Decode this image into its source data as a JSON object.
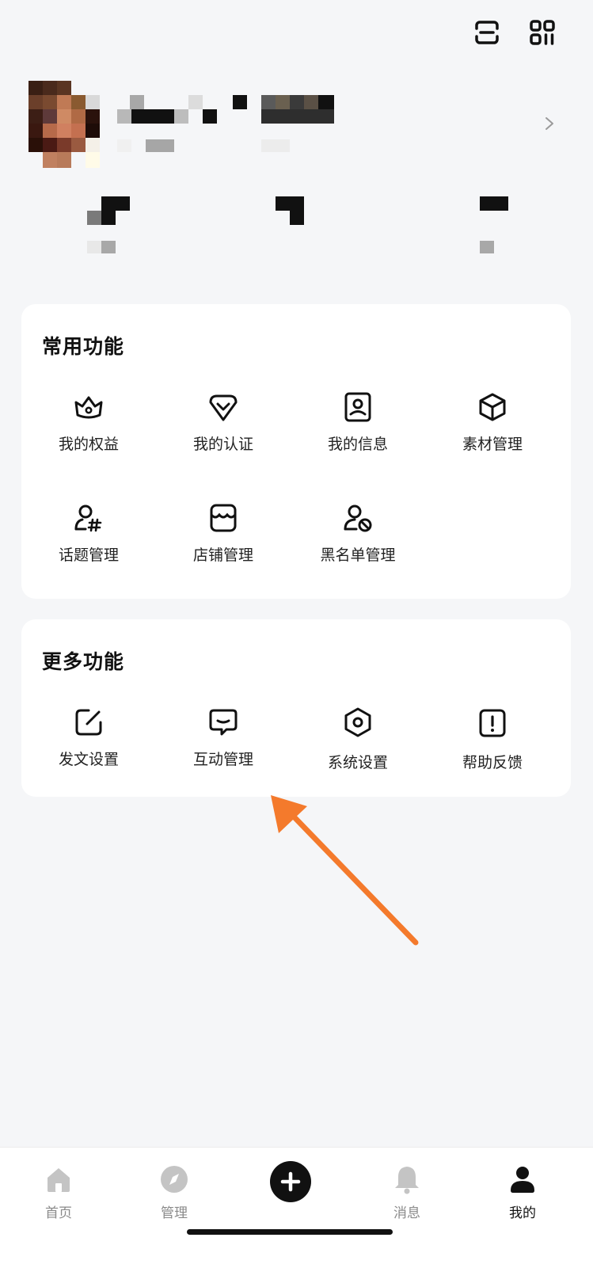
{
  "header": {
    "scan_icon": "scan-icon",
    "qr_icon": "qr-code-icon"
  },
  "profile": {
    "chevron_icon": "chevron-right-icon"
  },
  "common_functions": {
    "title": "常用功能",
    "items": [
      {
        "label": "我的权益",
        "icon": "crown-icon"
      },
      {
        "label": "我的认证",
        "icon": "badge-icon"
      },
      {
        "label": "我的信息",
        "icon": "user-card-icon"
      },
      {
        "label": "素材管理",
        "icon": "box-icon"
      },
      {
        "label": "话题管理",
        "icon": "user-hashtag-icon"
      },
      {
        "label": "店铺管理",
        "icon": "store-icon"
      },
      {
        "label": "黑名单管理",
        "icon": "user-block-icon"
      }
    ]
  },
  "more_functions": {
    "title": "更多功能",
    "items": [
      {
        "label": "发文设置",
        "icon": "edit-icon"
      },
      {
        "label": "互动管理",
        "icon": "chat-icon"
      },
      {
        "label": "系统设置",
        "icon": "settings-icon"
      },
      {
        "label": "帮助反馈",
        "icon": "help-icon"
      }
    ]
  },
  "bottom_nav": {
    "items": [
      {
        "label": "首页",
        "icon": "home-icon",
        "active": false
      },
      {
        "label": "管理",
        "icon": "compass-icon",
        "active": false
      },
      {
        "label": "",
        "icon": "add-icon",
        "active": false
      },
      {
        "label": "消息",
        "icon": "bell-icon",
        "active": false
      },
      {
        "label": "我的",
        "icon": "person-icon",
        "active": true
      }
    ]
  },
  "colors": {
    "accent_arrow": "#f47a2c",
    "background": "#f5f6f8"
  }
}
